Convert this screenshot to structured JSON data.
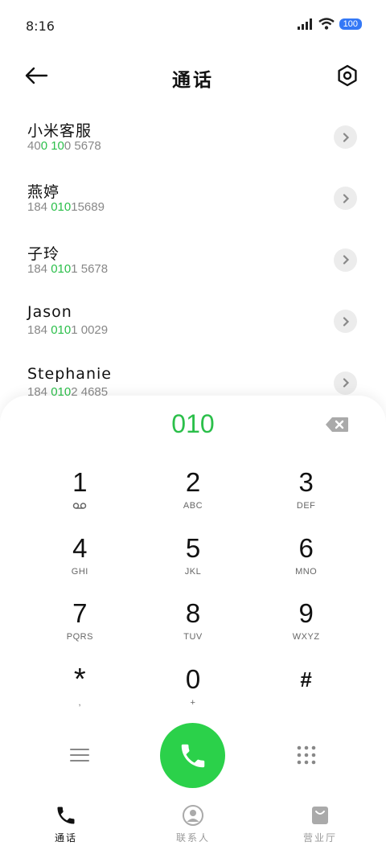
{
  "status_bar": {
    "time": "8:16",
    "battery": "100"
  },
  "header": {
    "title": "通话"
  },
  "contacts": [
    {
      "name": "小米客服",
      "number_parts": [
        "40",
        "0 10",
        "0 5678"
      ]
    },
    {
      "name": "燕婷",
      "number_parts": [
        "184 ",
        "010",
        "15689"
      ]
    },
    {
      "name": "子玲",
      "number_parts": [
        "184 ",
        "010",
        "1 5678"
      ]
    },
    {
      "name": "Jason",
      "number_parts": [
        "184 ",
        "010",
        "1 0029"
      ]
    },
    {
      "name": "Stephanie",
      "number_parts": [
        "184 ",
        "010",
        "2 4685"
      ]
    }
  ],
  "dialer": {
    "input": "010",
    "keys": [
      {
        "digit": "1",
        "letters": ""
      },
      {
        "digit": "2",
        "letters": "ABC"
      },
      {
        "digit": "3",
        "letters": "DEF"
      },
      {
        "digit": "4",
        "letters": "GHI"
      },
      {
        "digit": "5",
        "letters": "JKL"
      },
      {
        "digit": "6",
        "letters": "MNO"
      },
      {
        "digit": "7",
        "letters": "PQRS"
      },
      {
        "digit": "8",
        "letters": "TUV"
      },
      {
        "digit": "9",
        "letters": "WXYZ"
      },
      {
        "digit": "*",
        "letters": ","
      },
      {
        "digit": "0",
        "letters": "+"
      },
      {
        "digit": "#",
        "letters": ""
      }
    ]
  },
  "tabs": [
    {
      "label": "通话",
      "icon": "phone-icon"
    },
    {
      "label": "联系人",
      "icon": "contact-icon"
    },
    {
      "label": "营业厅",
      "icon": "bag-icon"
    }
  ],
  "colors": {
    "accent": "#2bbf4a",
    "call_button": "#2bd14a",
    "battery": "#3478f6"
  }
}
